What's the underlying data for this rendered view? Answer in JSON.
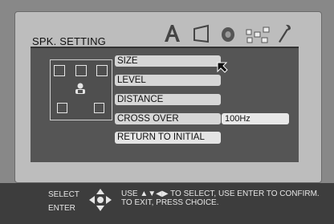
{
  "osd": {
    "title": "SPK. SETTING"
  },
  "tabs": [
    {
      "name": "language-tab",
      "icon": "letter-a-icon"
    },
    {
      "name": "video-tab",
      "icon": "screen-icon"
    },
    {
      "name": "audio-tab",
      "icon": "speaker-icon"
    },
    {
      "name": "speaker-tab",
      "icon": "speaker-setup-icon"
    },
    {
      "name": "preferences-tab",
      "icon": "wrench-icon"
    }
  ],
  "menu": {
    "size": "SIZE",
    "level": "LEVEL",
    "distance": "DISTANCE",
    "crossover": "CROSS OVER",
    "crossover_value": "100Hz",
    "return": "RETURN TO INITIAL"
  },
  "footer": {
    "select": "SELECT",
    "enter": "ENTER",
    "line1": "USE ▲▼◀▶ TO SELECT,  USE ENTER TO CONFIRM.",
    "line2": "TO EXIT, PRESS CHOICE."
  },
  "colors": {
    "panel": "#bdbdbd",
    "content": "#555555",
    "footer": "#3d3d3d"
  }
}
